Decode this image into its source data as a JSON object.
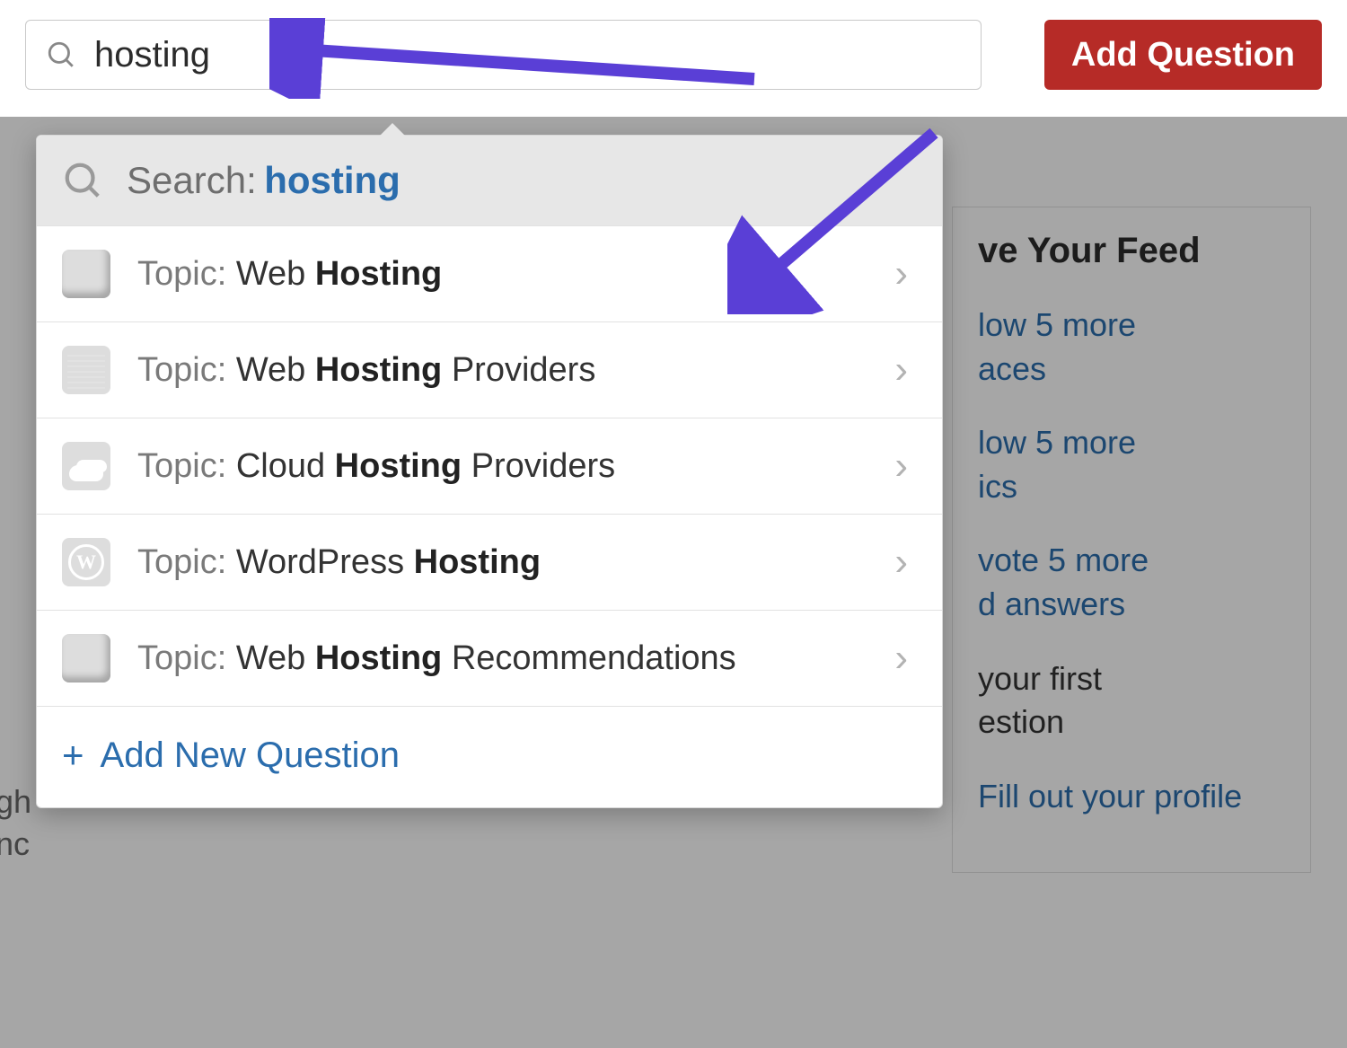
{
  "search": {
    "value": "hosting"
  },
  "buttons": {
    "add_question": "Add Question"
  },
  "dropdown": {
    "header_label": "Search:",
    "header_term": "hosting",
    "items": [
      {
        "prefix": "Topic: ",
        "before": "Web ",
        "bold": "Hosting",
        "after": "",
        "thumb": "globe"
      },
      {
        "prefix": "Topic: ",
        "before": "Web ",
        "bold": "Hosting",
        "after": " Providers",
        "thumb": "servers"
      },
      {
        "prefix": "Topic: ",
        "before": "Cloud ",
        "bold": "Hosting",
        "after": " Providers",
        "thumb": "cloud"
      },
      {
        "prefix": "Topic: ",
        "before": "WordPress ",
        "bold": "Hosting",
        "after": "",
        "thumb": "wp"
      },
      {
        "prefix": "Topic: ",
        "before": "Web ",
        "bold": "Hosting",
        "after": " Recommendations",
        "thumb": "globe"
      }
    ],
    "footer_plus": "+",
    "footer_label": "Add New Question"
  },
  "background": {
    "feed_title": "ve Your Feed",
    "links": [
      "low 5 more\naces",
      "low 5 more\nics",
      "vote 5 more\nd answers",
      "your first\nestion",
      "Fill out your profile"
    ],
    "left_frag_1": "gh",
    "left_frag_2": "nc"
  },
  "colors": {
    "accent_red": "#b62b27",
    "link_blue": "#2b6dad",
    "arrow": "#5a3fd6"
  }
}
